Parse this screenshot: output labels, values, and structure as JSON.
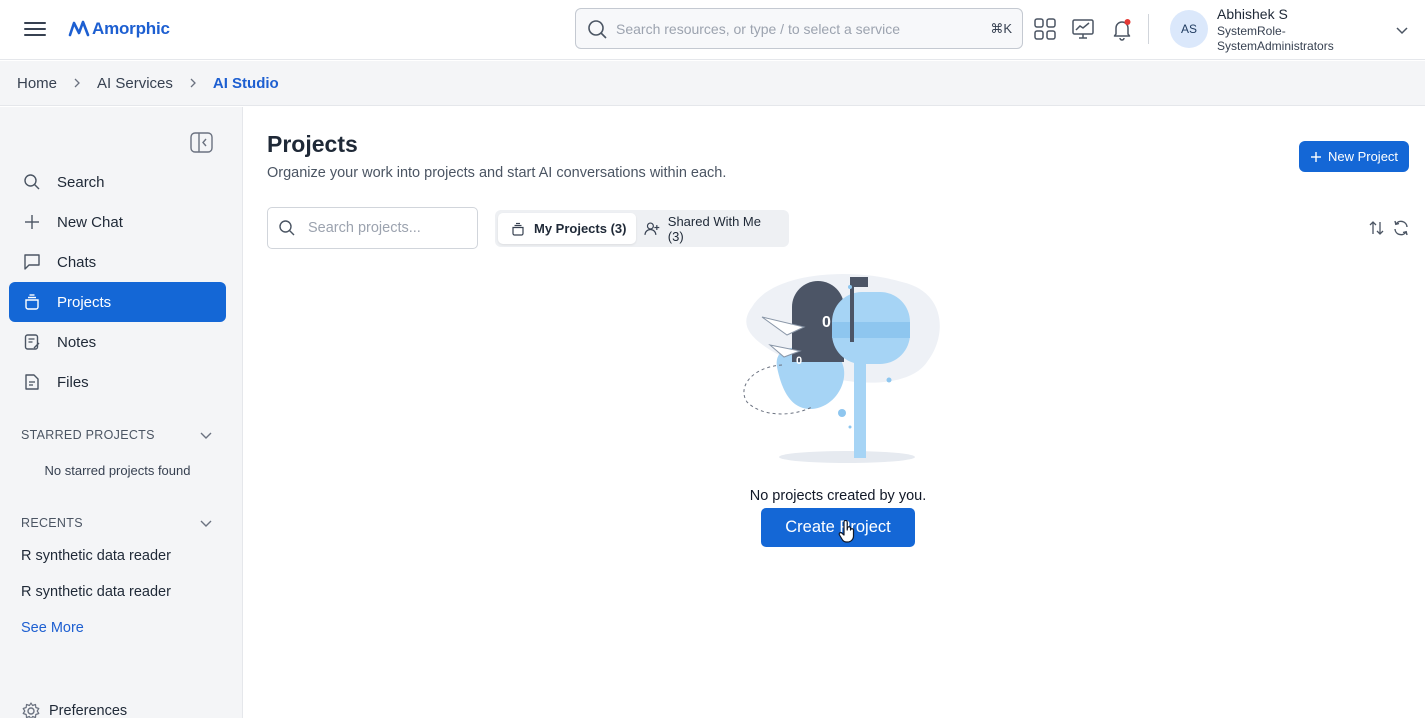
{
  "app": {
    "logo": "Amorphic"
  },
  "header": {
    "search_placeholder": "Search resources, or type / to select a service",
    "shortcut": "⌘K",
    "user": {
      "initials": "AS",
      "name": "Abhishek S",
      "role": "SystemRole-SystemAdministrators"
    },
    "notification_dot_color": "#e53935"
  },
  "breadcrumb": [
    {
      "label": "Home"
    },
    {
      "label": "AI Services"
    },
    {
      "label": "AI Studio"
    }
  ],
  "sidebar": {
    "items": [
      {
        "label": "Search",
        "icon": "search-icon"
      },
      {
        "label": "New Chat",
        "icon": "plus-icon"
      },
      {
        "label": "Chats",
        "icon": "chat-bubble-icon"
      },
      {
        "label": "Projects",
        "icon": "projects-icon",
        "active": true
      },
      {
        "label": "Notes",
        "icon": "note-icon"
      },
      {
        "label": "Files",
        "icon": "file-icon"
      }
    ],
    "starred": {
      "title": "STARRED PROJECTS",
      "empty": "No starred projects found"
    },
    "recents": {
      "title": "RECENTS",
      "items": [
        "R synthetic data reader",
        "R synthetic data reader"
      ],
      "see_more": "See More"
    },
    "preferences": "Preferences"
  },
  "main": {
    "title": "Projects",
    "subtitle": "Organize your work into projects and start AI conversations within each.",
    "new_project": "New Project",
    "search_placeholder": "Search projects...",
    "tabs": [
      {
        "label": "My Projects (3)",
        "active": true
      },
      {
        "label": "Shared With Me (3)",
        "active": false
      }
    ],
    "empty_message": "No projects created by you.",
    "create_button": "Create Project"
  },
  "colors": {
    "primary": "#1467d6",
    "link": "#1d5fd1",
    "sidebar_bg": "#f4f5f7"
  }
}
